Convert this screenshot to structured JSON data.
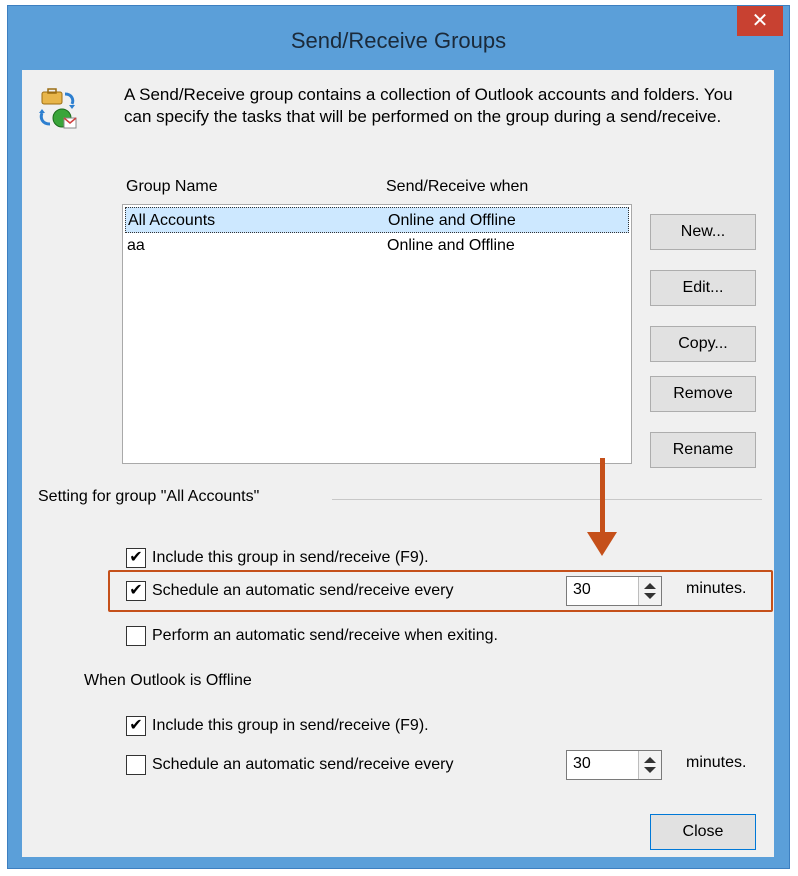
{
  "window": {
    "title": "Send/Receive Groups",
    "close_glyph": "✕"
  },
  "description": "A Send/Receive group contains a collection of Outlook accounts and folders. You can specify the tasks that will be performed on the group during a send/receive.",
  "icons": {
    "app": "send-receive-groups-icon",
    "close": "close-icon",
    "annotation": "arrow-down-icon"
  },
  "table": {
    "columns": [
      "Group Name",
      "Send/Receive when"
    ],
    "rows": [
      {
        "name": "All Accounts",
        "when": "Online and Offline",
        "selected": true
      },
      {
        "name": "aa",
        "when": "Online and Offline",
        "selected": false
      }
    ]
  },
  "side_buttons": [
    "New...",
    "Edit...",
    "Copy...",
    "Remove",
    "Rename"
  ],
  "group_settings": {
    "label": "Setting for group \"All Accounts\"",
    "online_options": [
      {
        "label": "Include this group in send/receive (F9).",
        "checked": true
      },
      {
        "label": "Schedule an automatic send/receive every",
        "checked": true,
        "value": "30",
        "suffix": "minutes."
      },
      {
        "label": "Perform an automatic send/receive when exiting.",
        "checked": false
      }
    ],
    "offline_label": "When Outlook is Offline",
    "offline_options": [
      {
        "label": "Include this group in send/receive (F9).",
        "checked": true
      },
      {
        "label": "Schedule an automatic send/receive every",
        "checked": false,
        "value": "30",
        "suffix": "minutes."
      }
    ]
  },
  "footer": {
    "close_label": "Close"
  },
  "colors": {
    "title_bar": "#5b9fd9",
    "close_button": "#c84131",
    "selection": "#cde8ff",
    "annotation": "#c5501a"
  },
  "check_glyph": "✔"
}
